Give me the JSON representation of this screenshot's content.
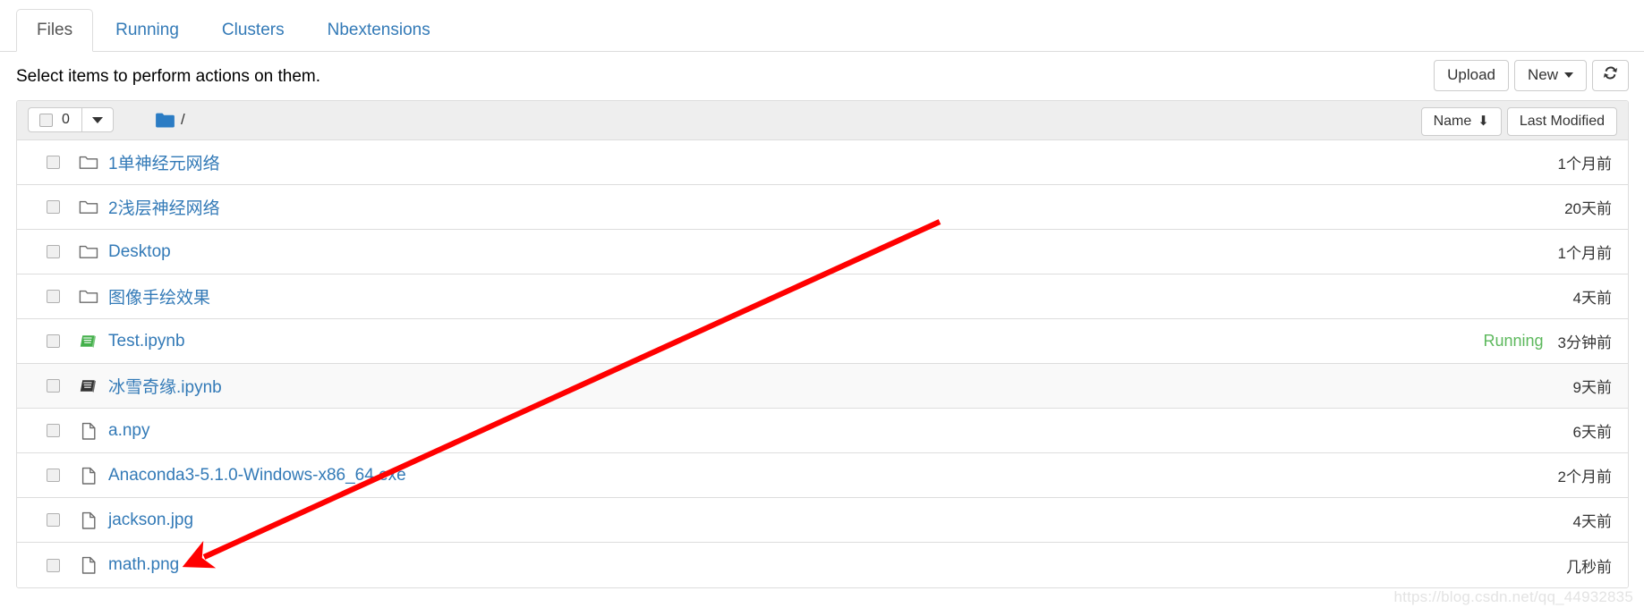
{
  "tabs": [
    {
      "label": "Files",
      "active": true
    },
    {
      "label": "Running",
      "active": false
    },
    {
      "label": "Clusters",
      "active": false
    },
    {
      "label": "Nbextensions",
      "active": false
    }
  ],
  "header": {
    "hint": "Select items to perform actions on them.",
    "upload_label": "Upload",
    "new_label": "New",
    "refresh_icon": "refresh-icon",
    "refresh_glyph": "↻"
  },
  "list_header": {
    "selected_count": "0",
    "select_all_icon": "checkbox-icon",
    "dropdown_icon": "caret-down-icon",
    "breadcrumb_folder_icon": "folder-icon",
    "breadcrumb_path": "/",
    "sort_name_label": "Name",
    "sort_name_arrow": "⬇",
    "sort_modified_label": "Last Modified"
  },
  "colors": {
    "link": "#337ab7",
    "running": "#5cb85c",
    "notebook_running": "#44b04b",
    "notebook_idle": "#333333",
    "folder_breadcrumb": "#2b7cc4",
    "arrow": "#ff0000",
    "header_bg": "#eeeeee",
    "alt_row_bg": "#f9f9f9",
    "border": "#dddddd"
  },
  "files": [
    {
      "name": "1单神经元网络",
      "type": "folder",
      "icon": "folder-icon",
      "status": "",
      "modified": "1个月前",
      "alt": false
    },
    {
      "name": "2浅层神经网络",
      "type": "folder",
      "icon": "folder-icon",
      "status": "",
      "modified": "20天前",
      "alt": false
    },
    {
      "name": "Desktop",
      "type": "folder",
      "icon": "folder-icon",
      "status": "",
      "modified": "1个月前",
      "alt": false
    },
    {
      "name": "图像手绘效果",
      "type": "folder",
      "icon": "folder-icon",
      "status": "",
      "modified": "4天前",
      "alt": false
    },
    {
      "name": "Test.ipynb",
      "type": "notebook-running",
      "icon": "notebook-icon",
      "status": "Running",
      "modified": "3分钟前",
      "alt": false
    },
    {
      "name": "冰雪奇缘.ipynb",
      "type": "notebook",
      "icon": "notebook-icon",
      "status": "",
      "modified": "9天前",
      "alt": true
    },
    {
      "name": "a.npy",
      "type": "file",
      "icon": "file-icon",
      "status": "",
      "modified": "6天前",
      "alt": false
    },
    {
      "name": "Anaconda3-5.1.0-Windows-x86_64.exe",
      "type": "file",
      "icon": "file-icon",
      "status": "",
      "modified": "2个月前",
      "alt": false
    },
    {
      "name": "jackson.jpg",
      "type": "file",
      "icon": "file-icon",
      "status": "",
      "modified": "4天前",
      "alt": false
    },
    {
      "name": "math.png",
      "type": "file",
      "icon": "file-icon",
      "status": "",
      "modified": "几秒前",
      "alt": false
    }
  ],
  "annotation": {
    "arrow_icon": "red-arrow-annotation",
    "points_to": "math.png"
  },
  "watermark": {
    "text": "https://blog.csdn.net/qq_44932835"
  }
}
